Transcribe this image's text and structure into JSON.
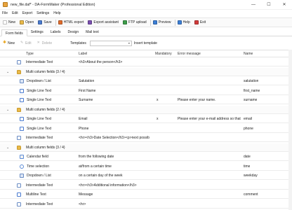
{
  "window": {
    "title": "new_file.daf* - DA-FormMaker (Professional Edition)",
    "controls": {
      "minimize": "—",
      "maximize": "☐",
      "close": "✕"
    }
  },
  "menu": [
    "File",
    "Edit",
    "Export",
    "Settings",
    "Help"
  ],
  "toolbar": [
    {
      "label": "New",
      "icon": "new-file-icon",
      "color": "#ffffff"
    },
    {
      "label": "Open",
      "icon": "folder-open-icon",
      "color": "#e9b949"
    },
    {
      "label": "Save",
      "icon": "save-icon",
      "color": "#4a7bd0"
    },
    {
      "label": "HTML export",
      "icon": "html-export-icon",
      "color": "#e06c2c"
    },
    {
      "label": "Export assistant",
      "icon": "export-assistant-icon",
      "color": "#7a4fb0"
    },
    {
      "label": "FTP upload",
      "icon": "ftp-upload-icon",
      "color": "#3d9e4a"
    },
    {
      "label": "Preview",
      "icon": "preview-icon",
      "color": "#3c7fd6"
    },
    {
      "label": "Help",
      "icon": "help-icon",
      "color": "#3c7fd6"
    },
    {
      "label": "Exit",
      "icon": "exit-icon",
      "color": "#d23b3b"
    }
  ],
  "tabs": [
    "Form fields",
    "Settings",
    "Labels",
    "Design",
    "Mail text"
  ],
  "active_tab": "Form fields",
  "subtoolbar": {
    "new": "New",
    "edit": "Edit",
    "delete": "Delete",
    "templates_label": "Templates",
    "insert": "Insert template"
  },
  "columns": {
    "type": "Type",
    "label": "Label",
    "mandatory": "Mandatory",
    "error": "Error message",
    "name": "Name"
  },
  "rows": [
    {
      "kind": "field",
      "icon": "text",
      "type": "Intermediate Text",
      "label": "<h3>About the person</h3>",
      "mandatory": "",
      "error": "",
      "name": ""
    },
    {
      "kind": "group",
      "type": "Multi column fields (3 / 4)"
    },
    {
      "kind": "child",
      "icon": "drop",
      "type": "Dropdown / List",
      "label": "Salutation",
      "mandatory": "",
      "error": "",
      "name": "salutation"
    },
    {
      "kind": "child",
      "icon": "single",
      "type": "Single Line Text",
      "label": "First Name",
      "mandatory": "",
      "error": "",
      "name": "first_name"
    },
    {
      "kind": "child",
      "icon": "single",
      "type": "Single Line Text",
      "label": "Surname",
      "mandatory": "x",
      "error": "Please enter your name.",
      "name": "surname"
    },
    {
      "kind": "group",
      "type": "Multi column fields (2 / 4)"
    },
    {
      "kind": "child",
      "icon": "single",
      "type": "Single Line Text",
      "label": "Email",
      "mandatory": "x",
      "error": "Please enter your e-mail address so that",
      "name": "email"
    },
    {
      "kind": "child",
      "icon": "single",
      "type": "Single Line Text",
      "label": "Phone",
      "mandatory": "",
      "error": "",
      "name": "phone"
    },
    {
      "kind": "field",
      "icon": "text",
      "type": "Intermediate Text",
      "label": "<hr><h3>Date Selection</h3><p>next possib",
      "mandatory": "",
      "error": "",
      "name": ""
    },
    {
      "kind": "group",
      "type": "Multi column fields (3 / 4)"
    },
    {
      "kind": "child",
      "icon": "cal",
      "type": "Calendar field",
      "label": "from the following date",
      "mandatory": "",
      "error": "",
      "name": "date"
    },
    {
      "kind": "child",
      "icon": "time",
      "type": "Time selection",
      "label": "at/from a certain time",
      "mandatory": "",
      "error": "",
      "name": "time"
    },
    {
      "kind": "child",
      "icon": "drop",
      "type": "Dropdown / List",
      "label": "on a certain day of the week",
      "mandatory": "",
      "error": "",
      "name": "weekday"
    },
    {
      "kind": "field",
      "icon": "text",
      "type": "Intermediate Text",
      "label": "<hr><h3>Additional information</h3>",
      "mandatory": "",
      "error": "",
      "name": ""
    },
    {
      "kind": "field",
      "icon": "multi",
      "type": "Multiline Text",
      "label": "Message",
      "mandatory": "",
      "error": "",
      "name": "comment"
    },
    {
      "kind": "field",
      "icon": "text",
      "type": "Intermediate Text",
      "label": "<hr>",
      "mandatory": "",
      "error": "",
      "name": ""
    }
  ]
}
